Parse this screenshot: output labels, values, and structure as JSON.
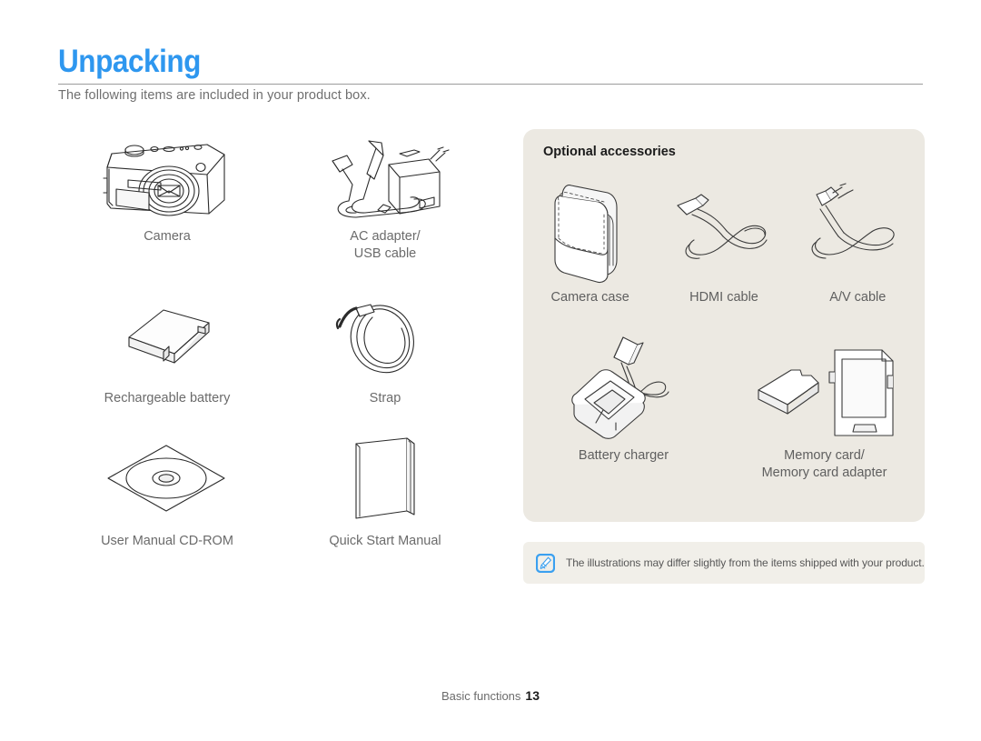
{
  "document": {
    "title": "Unpacking",
    "intro": "The following items are included in your product box.",
    "title_color": "#2e97ef"
  },
  "included_items": [
    {
      "label": "Camera",
      "icon": "camera-icon"
    },
    {
      "label": "AC adapter/\nUSB cable",
      "label_line1": "AC adapter/",
      "label_line2": "USB cable",
      "icon": "ac-adapter-usb-cable-icon"
    },
    {
      "label": "Rechargeable battery",
      "icon": "rechargeable-battery-icon"
    },
    {
      "label": "Strap",
      "icon": "strap-icon"
    },
    {
      "label": "User Manual CD-ROM",
      "icon": "cd-rom-icon"
    },
    {
      "label": "Quick Start Manual",
      "icon": "quick-start-manual-icon"
    }
  ],
  "optional_panel": {
    "title": "Optional accessories",
    "background_color": "#ece9e2",
    "items": [
      {
        "label": "Camera case",
        "icon": "camera-case-icon"
      },
      {
        "label": "HDMI cable",
        "icon": "hdmi-cable-icon"
      },
      {
        "label": "A/V cable",
        "icon": "av-cable-icon"
      },
      {
        "label": "Battery charger",
        "icon": "battery-charger-icon"
      },
      {
        "label": "Memory card/\nMemory card adapter",
        "label_line1": "Memory card/",
        "label_line2": "Memory card adapter",
        "icon": "memory-card-icon"
      }
    ]
  },
  "note": {
    "icon": "note-pen-icon",
    "icon_color": "#3aa0f0",
    "text": "The illustrations may differ slightly from the items shipped with your product."
  },
  "footer": {
    "section": "Basic functions",
    "page_number": "13"
  }
}
